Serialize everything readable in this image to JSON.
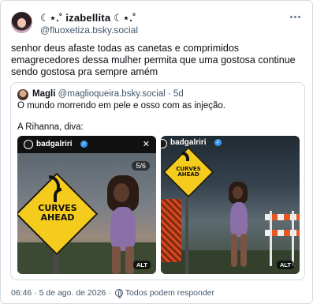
{
  "post": {
    "author_name": "☾⋆.˚ izabellita ☾⋆.˚",
    "author_handle": "@fluoxetiza.bsky.social",
    "more_icon": "more-horizontal-icon",
    "text": "senhor deus afaste todas as canetas e comprimidos emagrecedores dessa mulher permita que uma gostosa continue sendo gostosa pra sempre amém",
    "footer": {
      "timestamp": "06:46 · 5 de ago. de 2026",
      "separator": "·",
      "audience": "Todos podem responder"
    }
  },
  "quote": {
    "author_name": "Magli",
    "author_handle": "@maglioqueira.bsky.social",
    "time": "· 5d",
    "text_line1": "O mundo morrendo em pele e osso com as injeção.",
    "text_line2": "A Rihanna, diva:",
    "images": [
      {
        "account": "badgalriri",
        "sign_text": "CURVES AHEAD",
        "counter": "5/6",
        "alt_badge": "ALT"
      },
      {
        "account": "badgalriri",
        "sign_text": "CURVES AHEAD",
        "alt_badge": "ALT"
      }
    ]
  },
  "colors": {
    "text": "#0b0f14",
    "muted": "#42576c",
    "border": "#d4dbe2",
    "sign_yellow": "#f5cb1d",
    "verified_blue": "#3897f0"
  }
}
